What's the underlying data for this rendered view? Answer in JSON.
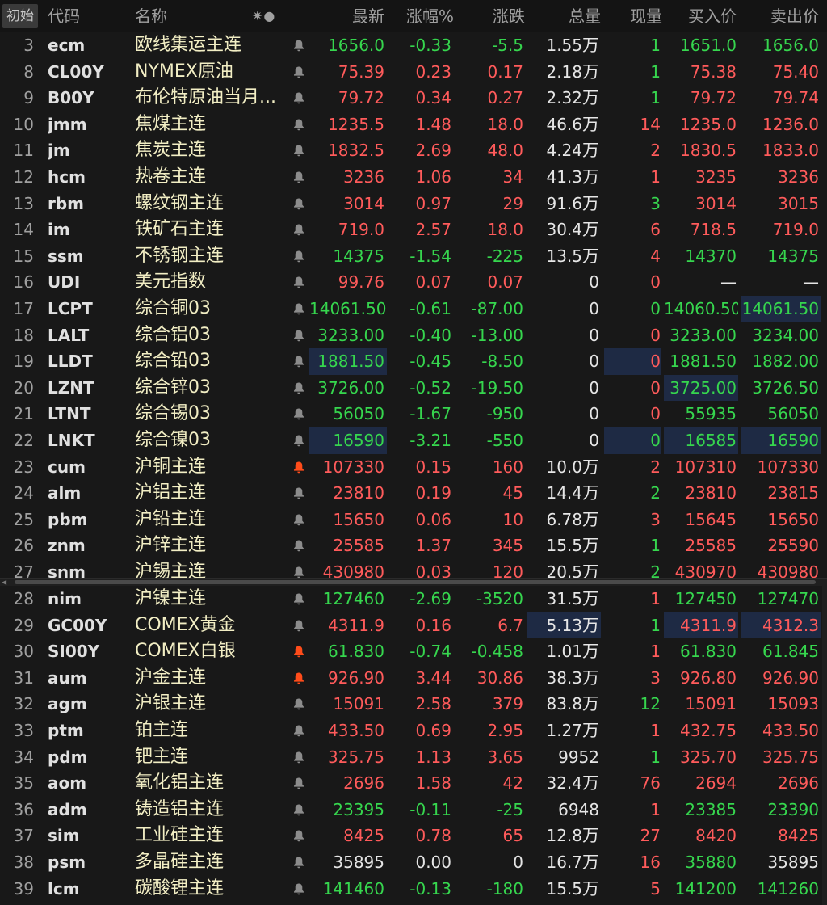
{
  "header": {
    "init_button": "初始",
    "icons_label": "✷●",
    "columns": {
      "code": "代码",
      "name": "名称",
      "last": "最新",
      "pct": "涨幅%",
      "chg": "涨跌",
      "vol": "总量",
      "cur": "现量",
      "bid": "买入价",
      "ask": "卖出价"
    }
  },
  "colors": {
    "up": "#ff5b5b",
    "down": "#36d64e",
    "flat": "#e6e6e6",
    "name": "#f2eec4",
    "alert": "#ff4c1a"
  },
  "groups": [
    {
      "rows": [
        {
          "idx": "3",
          "code": "ecm",
          "name": "欧线集运主连",
          "bell": "off",
          "last": "1656.0",
          "pct": "-0.33",
          "chg": "-5.5",
          "vol": "1.55",
          "vol_unit": "万",
          "cur": "1",
          "bid": "1651.0",
          "ask": "1656.0",
          "dir": "dn",
          "cur_dir": "dn"
        },
        {
          "idx": "8",
          "code": "CL00Y",
          "name": "NYMEX原油",
          "bell": "off",
          "last": "75.39",
          "pct": "0.23",
          "chg": "0.17",
          "vol": "2.18",
          "vol_unit": "万",
          "cur": "1",
          "bid": "75.38",
          "ask": "75.40",
          "dir": "up",
          "cur_dir": "dn"
        },
        {
          "idx": "9",
          "code": "B00Y",
          "name": "布伦特原油当月...",
          "bell": "off",
          "last": "79.72",
          "pct": "0.34",
          "chg": "0.27",
          "vol": "2.32",
          "vol_unit": "万",
          "cur": "1",
          "bid": "79.72",
          "ask": "79.74",
          "dir": "up",
          "cur_dir": "dn"
        },
        {
          "idx": "10",
          "code": "jmm",
          "name": "焦煤主连",
          "bell": "off",
          "last": "1235.5",
          "pct": "1.48",
          "chg": "18.0",
          "vol": "46.6",
          "vol_unit": "万",
          "cur": "14",
          "bid": "1235.0",
          "ask": "1236.0",
          "dir": "up",
          "cur_dir": "up"
        },
        {
          "idx": "11",
          "code": "jm",
          "name": "焦炭主连",
          "bell": "off",
          "last": "1832.5",
          "pct": "2.69",
          "chg": "48.0",
          "vol": "4.24",
          "vol_unit": "万",
          "cur": "2",
          "bid": "1830.5",
          "ask": "1833.0",
          "dir": "up",
          "cur_dir": "up"
        },
        {
          "idx": "12",
          "code": "hcm",
          "name": "热卷主连",
          "bell": "off",
          "last": "3236",
          "pct": "1.06",
          "chg": "34",
          "vol": "41.3",
          "vol_unit": "万",
          "cur": "1",
          "bid": "3235",
          "ask": "3236",
          "dir": "up",
          "cur_dir": "up"
        },
        {
          "idx": "13",
          "code": "rbm",
          "name": "螺纹钢主连",
          "bell": "off",
          "last": "3014",
          "pct": "0.97",
          "chg": "29",
          "vol": "91.6",
          "vol_unit": "万",
          "cur": "3",
          "bid": "3014",
          "ask": "3015",
          "dir": "up",
          "cur_dir": "dn"
        },
        {
          "idx": "14",
          "code": "im",
          "name": "铁矿石主连",
          "bell": "off",
          "last": "719.0",
          "pct": "2.57",
          "chg": "18.0",
          "vol": "30.4",
          "vol_unit": "万",
          "cur": "6",
          "bid": "718.5",
          "ask": "719.0",
          "dir": "up",
          "cur_dir": "up"
        },
        {
          "idx": "15",
          "code": "ssm",
          "name": "不锈钢主连",
          "bell": "off",
          "last": "14375",
          "pct": "-1.54",
          "chg": "-225",
          "vol": "13.5",
          "vol_unit": "万",
          "cur": "4",
          "bid": "14370",
          "ask": "14375",
          "dir": "dn",
          "cur_dir": "up"
        },
        {
          "idx": "16",
          "code": "UDI",
          "name": "美元指数",
          "bell": "off",
          "last": "99.76",
          "pct": "0.07",
          "chg": "0.07",
          "vol": "0",
          "vol_unit": "",
          "cur": "0",
          "bid": "—",
          "ask": "—",
          "dir": "up",
          "cur_dir": "up",
          "ba_dir": "fl"
        },
        {
          "idx": "17",
          "code": "LCPT",
          "name": "综合铜03",
          "bell": "off",
          "last": "14061.50",
          "pct": "-0.61",
          "chg": "-87.00",
          "vol": "0",
          "vol_unit": "",
          "cur": "0",
          "bid": "14060.50",
          "ask": "14061.50",
          "dir": "dn",
          "cur_dir": "dn",
          "hl_ask": true
        },
        {
          "idx": "18",
          "code": "LALT",
          "name": "综合铝03",
          "bell": "off",
          "last": "3233.00",
          "pct": "-0.40",
          "chg": "-13.00",
          "vol": "0",
          "vol_unit": "",
          "cur": "0",
          "bid": "3233.00",
          "ask": "3234.00",
          "dir": "dn",
          "cur_dir": "up"
        },
        {
          "idx": "19",
          "code": "LLDT",
          "name": "综合铅03",
          "bell": "off",
          "last": "1881.50",
          "pct": "-0.45",
          "chg": "-8.50",
          "vol": "0",
          "vol_unit": "",
          "cur": "0",
          "bid": "1881.50",
          "ask": "1882.00",
          "dir": "dn",
          "cur_dir": "up",
          "hl_last": true,
          "hl_cur": true
        },
        {
          "idx": "20",
          "code": "LZNT",
          "name": "综合锌03",
          "bell": "off",
          "last": "3726.00",
          "pct": "-0.52",
          "chg": "-19.50",
          "vol": "0",
          "vol_unit": "",
          "cur": "0",
          "bid": "3725.00",
          "ask": "3726.50",
          "dir": "dn",
          "cur_dir": "up",
          "hl_bid": true
        },
        {
          "idx": "21",
          "code": "LTNT",
          "name": "综合锡03",
          "bell": "off",
          "last": "56050",
          "pct": "-1.67",
          "chg": "-950",
          "vol": "0",
          "vol_unit": "",
          "cur": "0",
          "bid": "55935",
          "ask": "56050",
          "dir": "dn",
          "cur_dir": "up"
        },
        {
          "idx": "22",
          "code": "LNKT",
          "name": "综合镍03",
          "bell": "off",
          "last": "16590",
          "pct": "-3.21",
          "chg": "-550",
          "vol": "0",
          "vol_unit": "",
          "cur": "0",
          "bid": "16585",
          "ask": "16590",
          "dir": "dn",
          "cur_dir": "dn",
          "hl_last": true,
          "hl_cur": true,
          "hl_bid": true,
          "hl_ask": true
        },
        {
          "idx": "23",
          "code": "cum",
          "name": "沪铜主连",
          "bell": "on",
          "last": "107330",
          "pct": "0.15",
          "chg": "160",
          "vol": "10.0",
          "vol_unit": "万",
          "cur": "2",
          "bid": "107310",
          "ask": "107330",
          "dir": "up",
          "cur_dir": "up"
        },
        {
          "idx": "24",
          "code": "alm",
          "name": "沪铝主连",
          "bell": "off",
          "last": "23810",
          "pct": "0.19",
          "chg": "45",
          "vol": "14.4",
          "vol_unit": "万",
          "cur": "2",
          "bid": "23810",
          "ask": "23815",
          "dir": "up",
          "cur_dir": "dn"
        },
        {
          "idx": "25",
          "code": "pbm",
          "name": "沪铅主连",
          "bell": "off",
          "last": "15650",
          "pct": "0.06",
          "chg": "10",
          "vol": "6.78",
          "vol_unit": "万",
          "cur": "3",
          "bid": "15645",
          "ask": "15650",
          "dir": "up",
          "cur_dir": "up"
        },
        {
          "idx": "26",
          "code": "znm",
          "name": "沪锌主连",
          "bell": "off",
          "last": "25585",
          "pct": "1.37",
          "chg": "345",
          "vol": "15.5",
          "vol_unit": "万",
          "cur": "1",
          "bid": "25585",
          "ask": "25590",
          "dir": "up",
          "cur_dir": "dn"
        },
        {
          "idx": "27",
          "code": "snm",
          "name": "沪锡主连",
          "bell": "off",
          "last": "430980",
          "pct": "0.03",
          "chg": "120",
          "vol": "20.5",
          "vol_unit": "万",
          "cur": "2",
          "bid": "430970",
          "ask": "430980",
          "dir": "up",
          "cur_dir": "dn"
        }
      ]
    },
    {
      "rows": [
        {
          "idx": "28",
          "code": "nim",
          "name": "沪镍主连",
          "bell": "off",
          "last": "127460",
          "pct": "-2.69",
          "chg": "-3520",
          "vol": "31.5",
          "vol_unit": "万",
          "cur": "1",
          "bid": "127450",
          "ask": "127470",
          "dir": "dn",
          "cur_dir": "up"
        },
        {
          "idx": "29",
          "code": "GC00Y",
          "name": "COMEX黄金",
          "bell": "off",
          "last": "4311.9",
          "pct": "0.16",
          "chg": "6.7",
          "vol": "5.13",
          "vol_unit": "万",
          "cur": "1",
          "bid": "4311.9",
          "ask": "4312.3",
          "dir": "up",
          "cur_dir": "dn",
          "hl_vol": true,
          "hl_bid": true,
          "hl_ask": true
        },
        {
          "idx": "30",
          "code": "SI00Y",
          "name": "COMEX白银",
          "bell": "on",
          "last": "61.830",
          "pct": "-0.74",
          "chg": "-0.458",
          "vol": "1.01",
          "vol_unit": "万",
          "cur": "1",
          "bid": "61.830",
          "ask": "61.845",
          "dir": "dn",
          "cur_dir": "up"
        },
        {
          "idx": "31",
          "code": "aum",
          "name": "沪金主连",
          "bell": "on",
          "last": "926.90",
          "pct": "3.44",
          "chg": "30.86",
          "vol": "38.3",
          "vol_unit": "万",
          "cur": "3",
          "bid": "926.80",
          "ask": "926.90",
          "dir": "up",
          "cur_dir": "up"
        },
        {
          "idx": "32",
          "code": "agm",
          "name": "沪银主连",
          "bell": "off",
          "last": "15091",
          "pct": "2.58",
          "chg": "379",
          "vol": "83.8",
          "vol_unit": "万",
          "cur": "12",
          "bid": "15091",
          "ask": "15093",
          "dir": "up",
          "cur_dir": "dn"
        },
        {
          "idx": "33",
          "code": "ptm",
          "name": "铂主连",
          "bell": "off",
          "last": "433.50",
          "pct": "0.69",
          "chg": "2.95",
          "vol": "1.27",
          "vol_unit": "万",
          "cur": "1",
          "bid": "432.75",
          "ask": "433.50",
          "dir": "up",
          "cur_dir": "up"
        },
        {
          "idx": "34",
          "code": "pdm",
          "name": "钯主连",
          "bell": "off",
          "last": "325.75",
          "pct": "1.13",
          "chg": "3.65",
          "vol": "9952",
          "vol_unit": "",
          "cur": "1",
          "bid": "325.70",
          "ask": "325.75",
          "dir": "up",
          "cur_dir": "dn"
        },
        {
          "idx": "35",
          "code": "aom",
          "name": "氧化铝主连",
          "bell": "off",
          "last": "2696",
          "pct": "1.58",
          "chg": "42",
          "vol": "32.4",
          "vol_unit": "万",
          "cur": "76",
          "bid": "2694",
          "ask": "2696",
          "dir": "up",
          "cur_dir": "up"
        },
        {
          "idx": "36",
          "code": "adm",
          "name": "铸造铝主连",
          "bell": "off",
          "last": "23395",
          "pct": "-0.11",
          "chg": "-25",
          "vol": "6948",
          "vol_unit": "",
          "cur": "1",
          "bid": "23385",
          "ask": "23390",
          "dir": "dn",
          "cur_dir": "up"
        },
        {
          "idx": "37",
          "code": "sim",
          "name": "工业硅主连",
          "bell": "off",
          "last": "8425",
          "pct": "0.78",
          "chg": "65",
          "vol": "12.8",
          "vol_unit": "万",
          "cur": "27",
          "bid": "8420",
          "ask": "8425",
          "dir": "up",
          "cur_dir": "up"
        },
        {
          "idx": "38",
          "code": "psm",
          "name": "多晶硅主连",
          "bell": "off",
          "last": "35895",
          "pct": "0.00",
          "chg": "0",
          "vol": "16.7",
          "vol_unit": "万",
          "cur": "16",
          "bid": "35880",
          "ask": "35895",
          "dir": "fl",
          "cur_dir": "up",
          "bid_dir": "dn"
        },
        {
          "idx": "39",
          "code": "lcm",
          "name": "碳酸锂主连",
          "bell": "off",
          "last": "141460",
          "pct": "-0.13",
          "chg": "-180",
          "vol": "15.5",
          "vol_unit": "万",
          "cur": "5",
          "bid": "141200",
          "ask": "141260",
          "dir": "dn",
          "cur_dir": "up"
        }
      ]
    }
  ]
}
